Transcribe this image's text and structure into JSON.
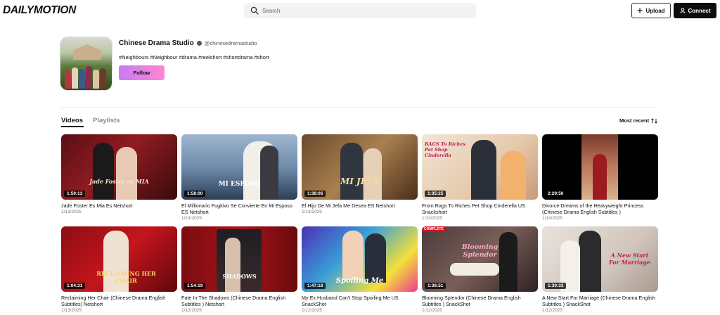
{
  "header": {
    "logo": "DAILYMOTION",
    "search_placeholder": "Search",
    "upload_label": "Upload",
    "connect_label": "Connect"
  },
  "channel": {
    "name": "Chinese Drama Studio",
    "handle": "@chinesedramastudio",
    "tags": "#Neighbours #Neighbour #drama #reelshort #shortdrama #short",
    "follow_label": "Follow"
  },
  "tabs": {
    "videos": "Videos",
    "playlists": "Playlists",
    "sort_label": "Most recent"
  },
  "icons": {
    "search": "search-icon",
    "plus": "plus-icon",
    "user": "user-icon",
    "sort": "sort-arrows-icon",
    "verified": "verified-icon"
  },
  "colors": {
    "follow_gradient_start": "#c87cf2",
    "follow_gradient_end": "#ff86d2",
    "connect_bg": "#0d0d0d"
  },
  "videos": [
    {
      "title": "Jade Foster Es Mia Es Netshort",
      "date": "1/13/2025",
      "duration": "1:50:13",
      "overlay": "Jade Foster es MIA"
    },
    {
      "title": "El Millionario Fugitivo Se Convierte En Mi Esposo ES Netshort",
      "date": "1/13/2025",
      "duration": "1:58:00",
      "overlay": "MI ESPOSO"
    },
    {
      "title": "El Hijo De Mi Jefa Me Desea ES Netshort",
      "date": "1/13/2025",
      "duration": "1:38:06",
      "overlay": "MI JEFA"
    },
    {
      "title": "From Rags To Riches Pet Shop Cinderella US Snackshort",
      "date": "1/13/2025",
      "duration": "1:35:25",
      "overlay": "RAGS To Riches Pet Shop Cinderella"
    },
    {
      "title": "Divorce Dreams of the Heavyweight Princess (Chinese Drama English Subtitles )",
      "date": "1/13/2025",
      "duration": "2:29:50",
      "overlay": ""
    },
    {
      "title": "Reclaiming Her Chair (Chinese Drama English Subtitles) Netshort",
      "date": "1/13/2025",
      "duration": "1:04:31",
      "overlay": "RECLAIMING HER CHAIR"
    },
    {
      "title": "Fate In The Shadows (Chinese Drama English Subtitles ) Netshort",
      "date": "1/12/2025",
      "duration": "1:54:19",
      "overlay": "SHADOWS"
    },
    {
      "title": "My Ex Husband Can't Stop Spoiling Me US SnackShot",
      "date": "1/12/2025",
      "duration": "1:47:18",
      "overlay": "Spoiling Me"
    },
    {
      "title": "Blooming Splendor (Chinese Drama English Subtitles ) SnackShot",
      "date": "1/12/2025",
      "duration": "1:38:51",
      "overlay": "Blooming Splendor",
      "badge": "COMPLETE"
    },
    {
      "title": "A New Start For Marriage (Chinese Drama English Subtitles ) SnackShot",
      "date": "1/12/2025",
      "duration": "1:30:33",
      "overlay": "A New Start For Marriage"
    }
  ]
}
